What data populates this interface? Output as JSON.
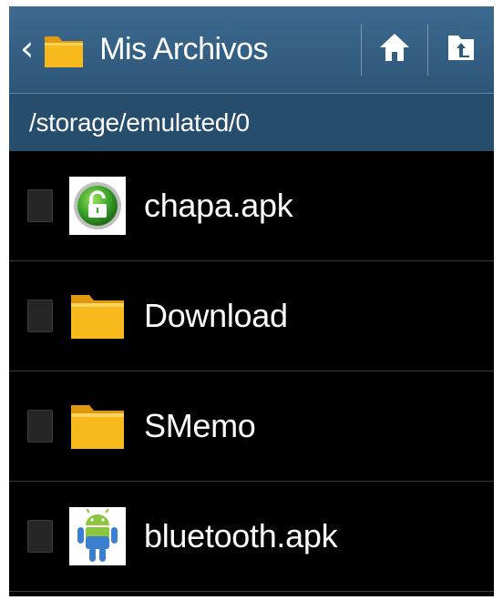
{
  "header": {
    "title": "Mis Archivos",
    "back_icon": "chevron-left-icon",
    "app_icon": "folder-icon",
    "home_icon": "home-icon",
    "up_icon": "folder-up-icon"
  },
  "path": "/storage/emulated/0",
  "files": [
    {
      "name": "chapa.apk",
      "icon": "unlock-app-icon",
      "type": "apk"
    },
    {
      "name": "Download",
      "icon": "folder-icon",
      "type": "folder"
    },
    {
      "name": "SMemo",
      "icon": "folder-icon",
      "type": "folder"
    },
    {
      "name": "bluetooth.apk",
      "icon": "android-app-icon",
      "type": "apk"
    }
  ],
  "colors": {
    "actionbar": "#2f5a7c",
    "pathbar": "#264d6b",
    "folder": "#f5b41a",
    "background": "#000000"
  }
}
